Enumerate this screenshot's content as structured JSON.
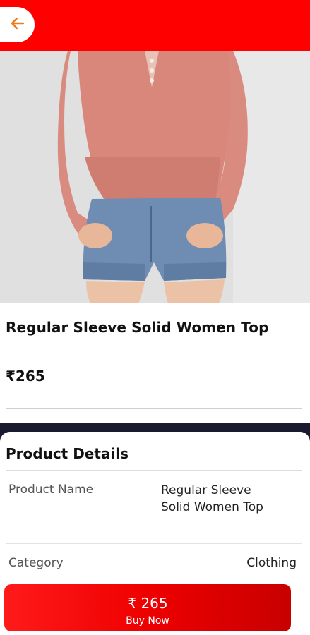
{
  "header": {
    "back_icon": "arrow-left-icon",
    "accent": "#ff0000"
  },
  "product": {
    "title": "Regular Sleeve Solid Women  Top",
    "price": "₹265"
  },
  "details": {
    "heading": "Product Details",
    "rows": [
      {
        "label": "Product Name",
        "value_line1": "Regular Sleeve",
        "value_line2": "Solid Women  Top"
      },
      {
        "label": "Category",
        "value": "Clothing"
      }
    ]
  },
  "buy": {
    "price": "₹ 265",
    "label": "Buy Now"
  }
}
